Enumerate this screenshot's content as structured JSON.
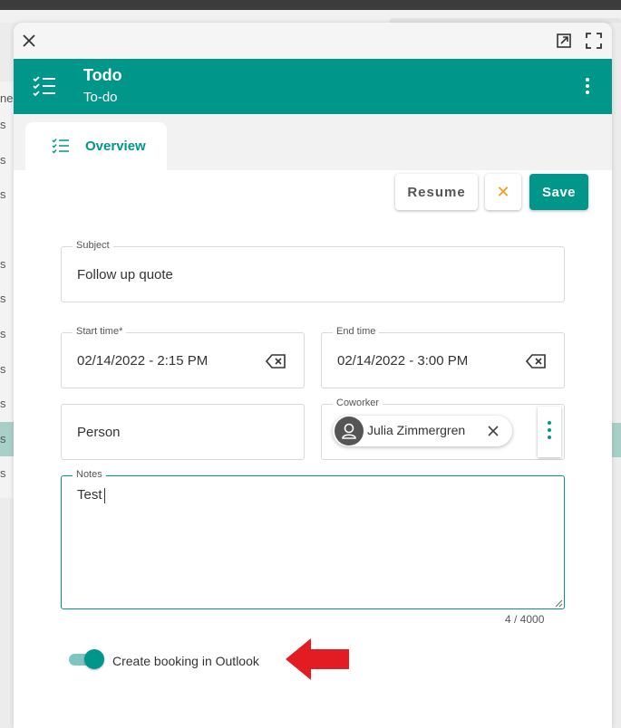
{
  "background": {
    "rows": [
      "ne",
      "s",
      "s",
      "s",
      "",
      "s",
      "s",
      "s",
      "s",
      "s",
      "s",
      "s"
    ]
  },
  "dialog": {
    "header": {
      "title": "Todo",
      "subtitle": "To-do"
    },
    "tabs": [
      {
        "label": "Overview"
      }
    ],
    "actions": {
      "resume_label": "Resume",
      "cancel_label": "✕",
      "save_label": "Save"
    },
    "form": {
      "subject": {
        "label": "Subject",
        "value": "Follow up quote"
      },
      "start_time": {
        "label": "Start time*",
        "value": "02/14/2022 - 2:15 PM"
      },
      "end_time": {
        "label": "End time",
        "value": "02/14/2022 - 3:00 PM"
      },
      "person": {
        "placeholder": "Person"
      },
      "coworker": {
        "label": "Coworker",
        "chip_name": "Julia Zimmergren"
      },
      "notes": {
        "label": "Notes",
        "value": "Test",
        "counter": "4 / 4000"
      },
      "outlook_toggle": {
        "label": "Create booking in Outlook",
        "checked": true
      }
    }
  },
  "colors": {
    "accent": "#00968a",
    "cancel": "#f59a1b",
    "arrow": "#e31b23"
  }
}
